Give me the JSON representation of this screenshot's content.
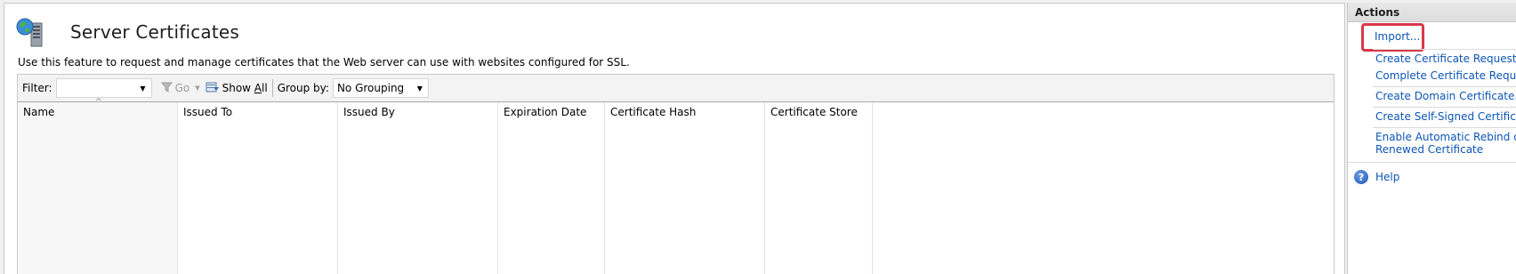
{
  "page": {
    "title": "Server Certificates",
    "description": "Use this feature to request and manage certificates that the Web server can use with websites configured for SSL."
  },
  "toolbar": {
    "filter_label": "Filter:",
    "filter_value": "",
    "go_label": "Go",
    "show_all_label_prefix": "Show ",
    "show_all_label_underlined": "A",
    "show_all_label_suffix": "ll",
    "group_by_label": "Group by:",
    "group_by_value": "No Grouping"
  },
  "columns": [
    "Name",
    "Issued To",
    "Issued By",
    "Expiration Date",
    "Certificate Hash",
    "Certificate Store"
  ],
  "actions": {
    "header": "Actions",
    "items": [
      "Import...",
      "Create Certificate Request...",
      "Complete Certificate Request...",
      "Create Domain Certificate...",
      "Create Self-Signed Certificate...",
      "Enable Automatic Rebind of",
      "Renewed Certificate",
      "Help"
    ]
  },
  "colors": {
    "link": "#0c55b4",
    "highlight": "#d8394a"
  }
}
